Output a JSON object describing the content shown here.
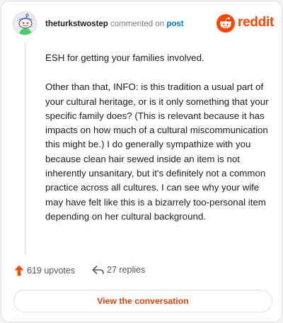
{
  "header": {
    "username": "theturkstwostep",
    "action_text": "commented on",
    "post_link": "post",
    "brand": "reddit"
  },
  "comment": {
    "paragraphs": [
      "ESH for getting your families involved.",
      "Other than that, INFO: is this tradition a usual part of your cultural heritage, or is it only something that your specific family does? (This is relevant because it has impacts on how much of a cultural miscommunication this might be.) I do generally sympathize with you because clean hair sewed inside an item is not inherently unsanitary, but it's definitely not a common practice across all cultures. I can see why your wife may have felt like this is a bizarrely too-personal item depending on her cultural background."
    ]
  },
  "stats": {
    "upvotes": "619 upvotes",
    "replies": "27 replies"
  },
  "actions": {
    "view_conversation": "View the conversation"
  },
  "colors": {
    "brand": "#ff4500",
    "link": "#0079d3",
    "button_text": "#e0420b"
  },
  "icons": {
    "avatar": "snoo-avatar-icon",
    "logo": "reddit-logo-icon",
    "upvote": "upvote-arrow-icon",
    "reply": "reply-arrow-icon"
  }
}
